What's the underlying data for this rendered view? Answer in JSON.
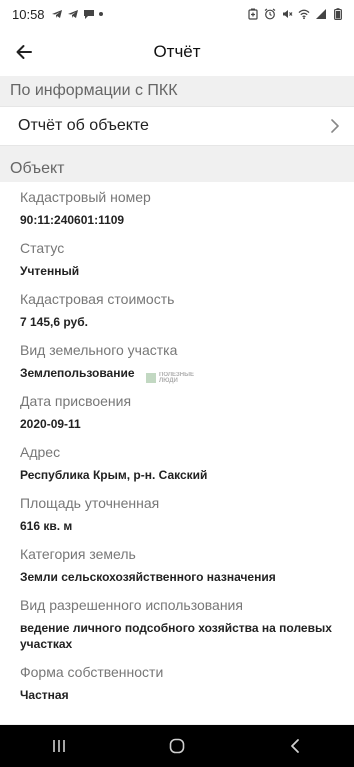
{
  "status_bar": {
    "time": "10:58",
    "left_icons": [
      "telegram-icon",
      "telegram-icon",
      "chat-icon",
      "dot-icon"
    ],
    "right_icons": [
      "battery-saver-icon",
      "alarm-icon",
      "mute-icon",
      "wifi-icon",
      "signal-icon",
      "battery-icon"
    ]
  },
  "app_bar": {
    "title": "Отчёт"
  },
  "sections": {
    "pkk_header": "По информации с ПКК",
    "report_row_label": "Отчёт об объекте",
    "object_header": "Объект"
  },
  "fields": [
    {
      "label": "Кадастровый номер",
      "value": "90:11:240601:1109"
    },
    {
      "label": "Статус",
      "value": "Учтенный"
    },
    {
      "label": "Кадастровая стоимость",
      "value": "7 145,6 руб."
    },
    {
      "label": "Вид земельного участка",
      "value": "Землепользование"
    },
    {
      "label": "Дата присвоения",
      "value": "2020-09-11"
    },
    {
      "label": "Адрес",
      "value": "Республика Крым, р-н. Сакский"
    },
    {
      "label": "Площадь уточненная",
      "value": "616 кв. м"
    },
    {
      "label": "Категория земель",
      "value": "Земли сельскохозяйственного назначения"
    },
    {
      "label": "Вид разрешенного использования",
      "value": "ведение личного подсобного хозяйства на полевых участках"
    },
    {
      "label": "Форма собственности",
      "value": "Частная"
    }
  ],
  "watermark": {
    "line1": "ПОЛЕЗНЫЕ",
    "line2": "ЛЮДИ"
  },
  "colors": {
    "app_background": "#f0f0f0",
    "surface": "#ffffff",
    "nav_bar": "#000000"
  }
}
